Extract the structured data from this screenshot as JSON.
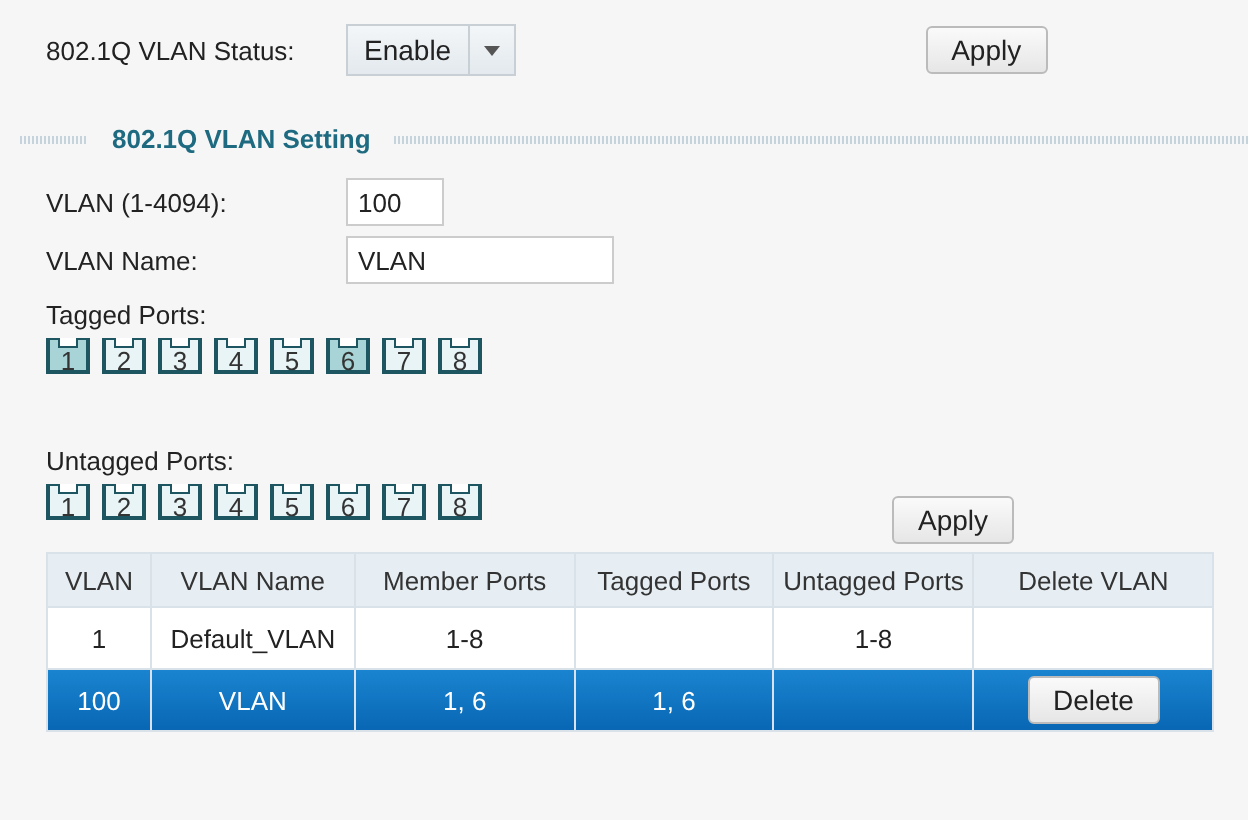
{
  "status": {
    "label": "802.1Q VLAN Status:",
    "value": "Enable",
    "apply": "Apply"
  },
  "section": {
    "title": "802.1Q VLAN Setting"
  },
  "vlan_id": {
    "label": "VLAN (1-4094):",
    "value": "100"
  },
  "vlan_name": {
    "label": "VLAN Name:",
    "value": "VLAN"
  },
  "tagged_ports": {
    "label": "Tagged Ports:",
    "ports": [
      {
        "label": "1",
        "selected": true
      },
      {
        "label": "2",
        "selected": false
      },
      {
        "label": "3",
        "selected": false
      },
      {
        "label": "4",
        "selected": false
      },
      {
        "label": "5",
        "selected": false
      },
      {
        "label": "6",
        "selected": true
      },
      {
        "label": "7",
        "selected": false
      },
      {
        "label": "8",
        "selected": false
      }
    ]
  },
  "untagged_ports": {
    "label": "Untagged Ports:",
    "ports": [
      {
        "label": "1",
        "selected": false
      },
      {
        "label": "2",
        "selected": false
      },
      {
        "label": "3",
        "selected": false
      },
      {
        "label": "4",
        "selected": false
      },
      {
        "label": "5",
        "selected": false
      },
      {
        "label": "6",
        "selected": false
      },
      {
        "label": "7",
        "selected": false
      },
      {
        "label": "8",
        "selected": false
      }
    ]
  },
  "apply": "Apply",
  "table": {
    "columns": [
      "VLAN",
      "VLAN Name",
      "Member Ports",
      "Tagged Ports",
      "Untagged Ports",
      "Delete VLAN"
    ],
    "rows": [
      {
        "selected": false,
        "cells": [
          "1",
          "Default_VLAN",
          "1-8",
          "",
          "1-8"
        ]
      },
      {
        "selected": true,
        "cells": [
          "100",
          "VLAN",
          "1, 6",
          "1, 6",
          ""
        ],
        "delete": "Delete"
      }
    ]
  }
}
